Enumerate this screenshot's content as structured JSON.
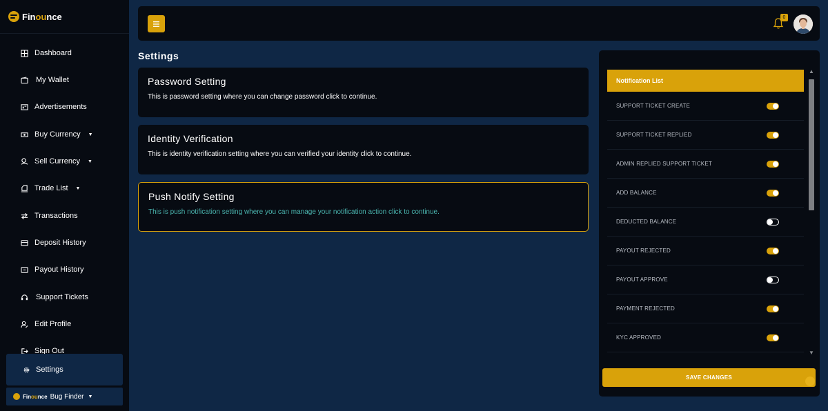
{
  "brand": {
    "prefix": "Fin",
    "accent": "ou",
    "suffix": "nce"
  },
  "sidebar": {
    "items": [
      {
        "label": "Dashboard",
        "icon": "dashboard-icon",
        "caret": false
      },
      {
        "label": "My Wallet",
        "icon": "wallet-icon",
        "caret": false
      },
      {
        "label": "Advertisements",
        "icon": "advertisement-icon",
        "caret": false
      },
      {
        "label": "Buy Currency",
        "icon": "buy-currency-icon",
        "caret": true
      },
      {
        "label": "Sell Currency",
        "icon": "sell-currency-icon",
        "caret": true
      },
      {
        "label": "Trade List",
        "icon": "trade-list-icon",
        "caret": true
      },
      {
        "label": "Transactions",
        "icon": "transactions-icon",
        "caret": false
      },
      {
        "label": "Deposit History",
        "icon": "deposit-history-icon",
        "caret": false
      },
      {
        "label": "Payout History",
        "icon": "payout-history-icon",
        "caret": false
      },
      {
        "label": "Support Tickets",
        "icon": "support-tickets-icon",
        "caret": false
      },
      {
        "label": "Edit Profile",
        "icon": "edit-profile-icon",
        "caret": false
      },
      {
        "label": "Sign Out",
        "icon": "sign-out-icon",
        "caret": false
      }
    ],
    "active": {
      "label": "Settings",
      "icon": "gear-icon"
    },
    "user": {
      "brand_prefix": "Fin",
      "brand_accent": "ou",
      "brand_suffix": "nce",
      "name": "Bug Finder"
    }
  },
  "topbar": {
    "notification_count": "0"
  },
  "page": {
    "title": "Settings",
    "cards": [
      {
        "title": "Password Setting",
        "description": "This is password setting where you can change password click to continue."
      },
      {
        "title": "Identity Verification",
        "description": "This is identity verification setting where you can verified your identity click to continue."
      },
      {
        "title": "Push Notify Setting",
        "description": "This is push notification setting where you can manage your notification action click to continue."
      }
    ]
  },
  "notifications": {
    "header": "Notification List",
    "items": [
      {
        "label": "SUPPORT TICKET CREATE",
        "enabled": true
      },
      {
        "label": "SUPPORT TICKET REPLIED",
        "enabled": true
      },
      {
        "label": "ADMIN REPLIED SUPPORT TICKET",
        "enabled": true
      },
      {
        "label": "ADD BALANCE",
        "enabled": true
      },
      {
        "label": "DEDUCTED BALANCE",
        "enabled": false
      },
      {
        "label": "PAYOUT REJECTED",
        "enabled": true
      },
      {
        "label": "PAYOUT APPROVE",
        "enabled": false
      },
      {
        "label": "PAYMENT REJECTED",
        "enabled": true
      },
      {
        "label": "KYC APPROVED",
        "enabled": true
      }
    ],
    "save_label": "SAVE CHANGES"
  },
  "colors": {
    "accent": "#d9a20a",
    "background": "#0f2745",
    "panel": "#070b12",
    "link_text": "#4bb6b0"
  }
}
